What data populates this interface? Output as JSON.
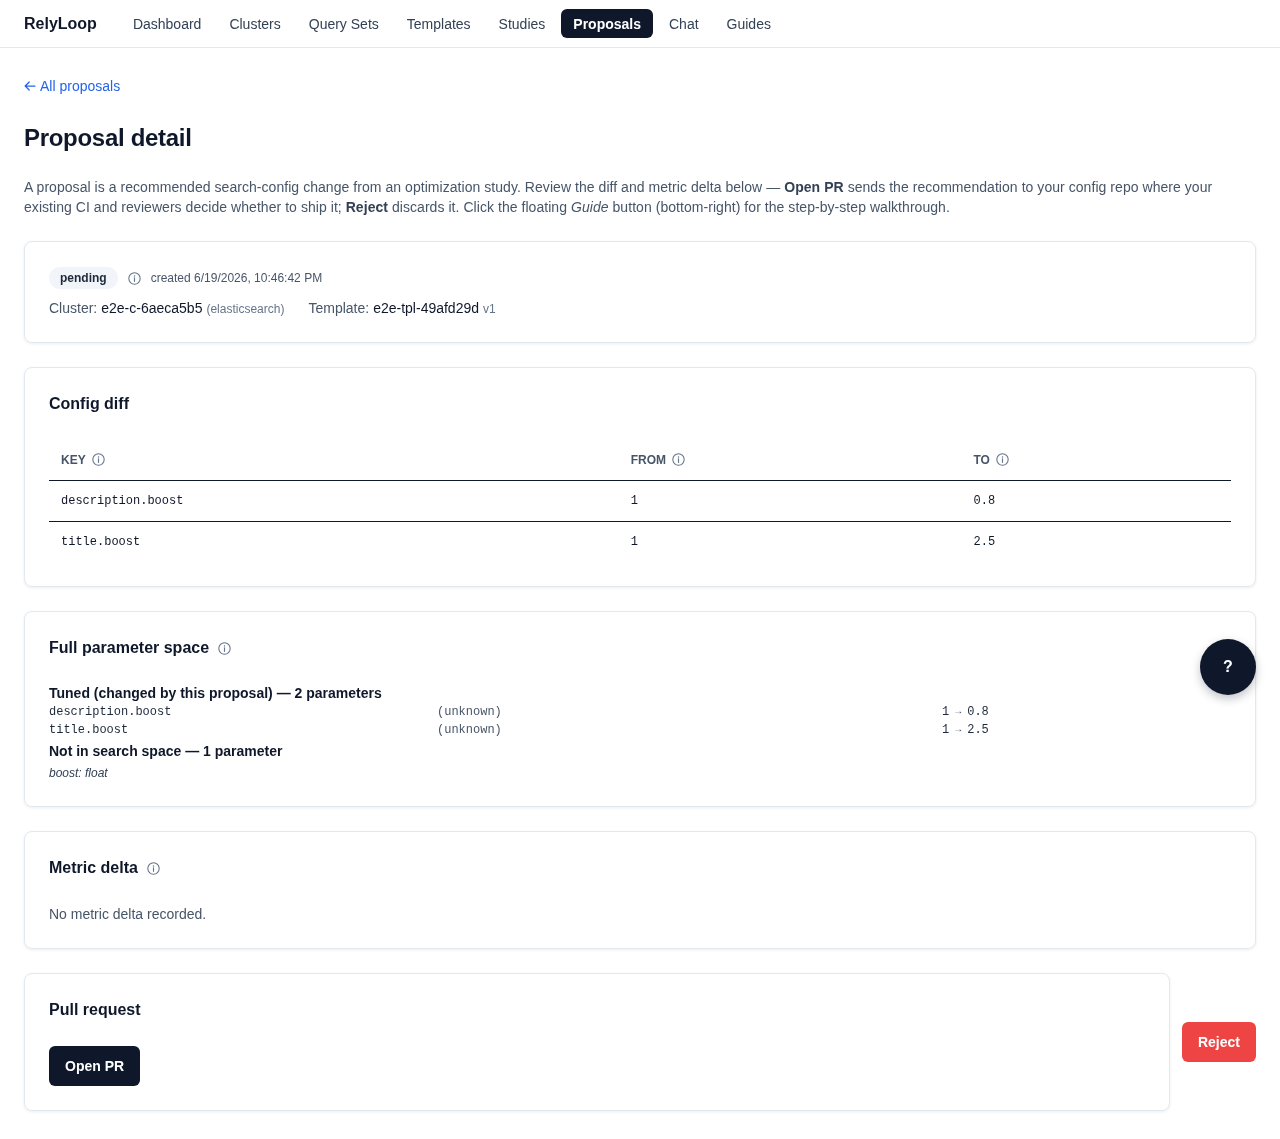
{
  "nav": {
    "brand": "RelyLoop",
    "items": [
      {
        "label": "Dashboard",
        "selected": false
      },
      {
        "label": "Clusters",
        "selected": false
      },
      {
        "label": "Query Sets",
        "selected": false
      },
      {
        "label": "Templates",
        "selected": false
      },
      {
        "label": "Studies",
        "selected": false
      },
      {
        "label": "Proposals",
        "selected": true
      },
      {
        "label": "Chat",
        "selected": false
      },
      {
        "label": "Guides",
        "selected": false
      }
    ]
  },
  "back_link": "All proposals",
  "page_title": "Proposal detail",
  "description": "A proposal is a recommended search-config change from an optimization study. Review the diff and metric delta below — **Open PR** sends the recommendation to your config repo where your existing CI and reviewers decide whether to ship it; **Reject** discards it. Click the floating *Guide* button (bottom-right) for the step-by-step walkthrough.",
  "summary": {
    "status": "pending",
    "created": "created 6/19/2026, 10:46:42 PM",
    "cluster_label": "Cluster:",
    "cluster": "e2e-c-6aeca5b5",
    "cluster_engine": "(elasticsearch)",
    "template_label": "Template:",
    "template": "e2e-tpl-49afd29d",
    "template_version": "v1"
  },
  "config_diff": {
    "title": "Config diff",
    "columns": [
      "KEY",
      "FROM",
      "TO"
    ],
    "rows": [
      [
        "description.boost",
        "1",
        "0.8"
      ],
      [
        "title.boost",
        "1",
        "2.5"
      ]
    ]
  },
  "parameter_space": {
    "title": "Full parameter space",
    "tuned_heading": "Tuned (changed by this proposal) — 2 parameters",
    "tuned": [
      {
        "name": "description.boost",
        "type": "(unknown)",
        "from": "1",
        "arrow": "→",
        "to": "0.8"
      },
      {
        "name": "title.boost",
        "type": "(unknown)",
        "from": "1",
        "arrow": "→",
        "to": "2.5"
      }
    ],
    "not_in_space_heading": "Not in search space — 1 parameter",
    "not_in_space": [
      "boost: float"
    ]
  },
  "metric_delta": {
    "title": "Metric delta",
    "empty_text": "No metric delta recorded."
  },
  "pull_request": {
    "title": "Pull request",
    "open_button": "Open PR"
  },
  "reject_button": "Reject",
  "help_button": "?"
}
